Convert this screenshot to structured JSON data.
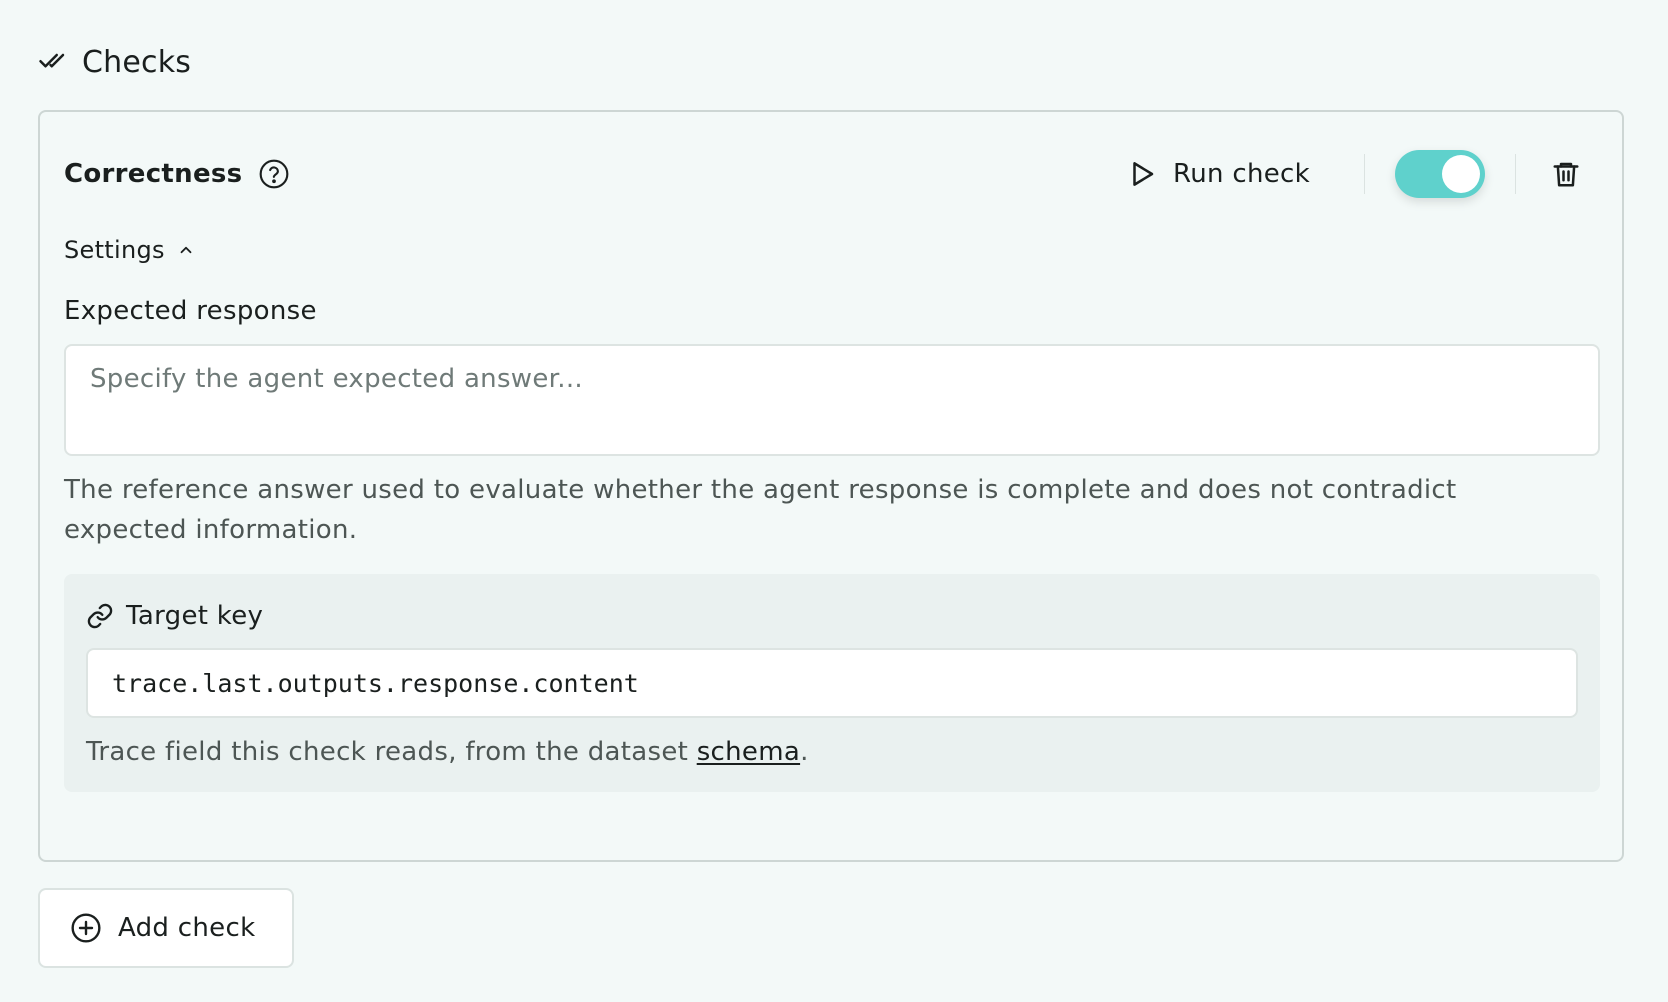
{
  "section": {
    "title": "Checks",
    "icon": "double-check-icon"
  },
  "check": {
    "name": "Correctness",
    "help_icon": "help-circle-icon",
    "run_label": "Run check",
    "run_icon": "play-icon",
    "enabled": true,
    "toggle_color": "#5fd1cc",
    "delete_icon": "trash-icon",
    "settings": {
      "label": "Settings",
      "expanded": true,
      "chevron_icon": "chevron-up-icon"
    },
    "expected_response": {
      "label": "Expected response",
      "value": "",
      "placeholder": "Specify the agent expected answer...",
      "hint": "The reference answer used to evaluate whether the agent response is complete and does not contradict expected information."
    },
    "target_key": {
      "label": "Target key",
      "icon": "link-icon",
      "value": "trace.last.outputs.response.content",
      "hint_prefix": "Trace field this check reads, from the dataset ",
      "hint_link": "schema",
      "hint_suffix": "."
    }
  },
  "add_check": {
    "label": "Add check",
    "icon": "plus-circle-icon"
  }
}
